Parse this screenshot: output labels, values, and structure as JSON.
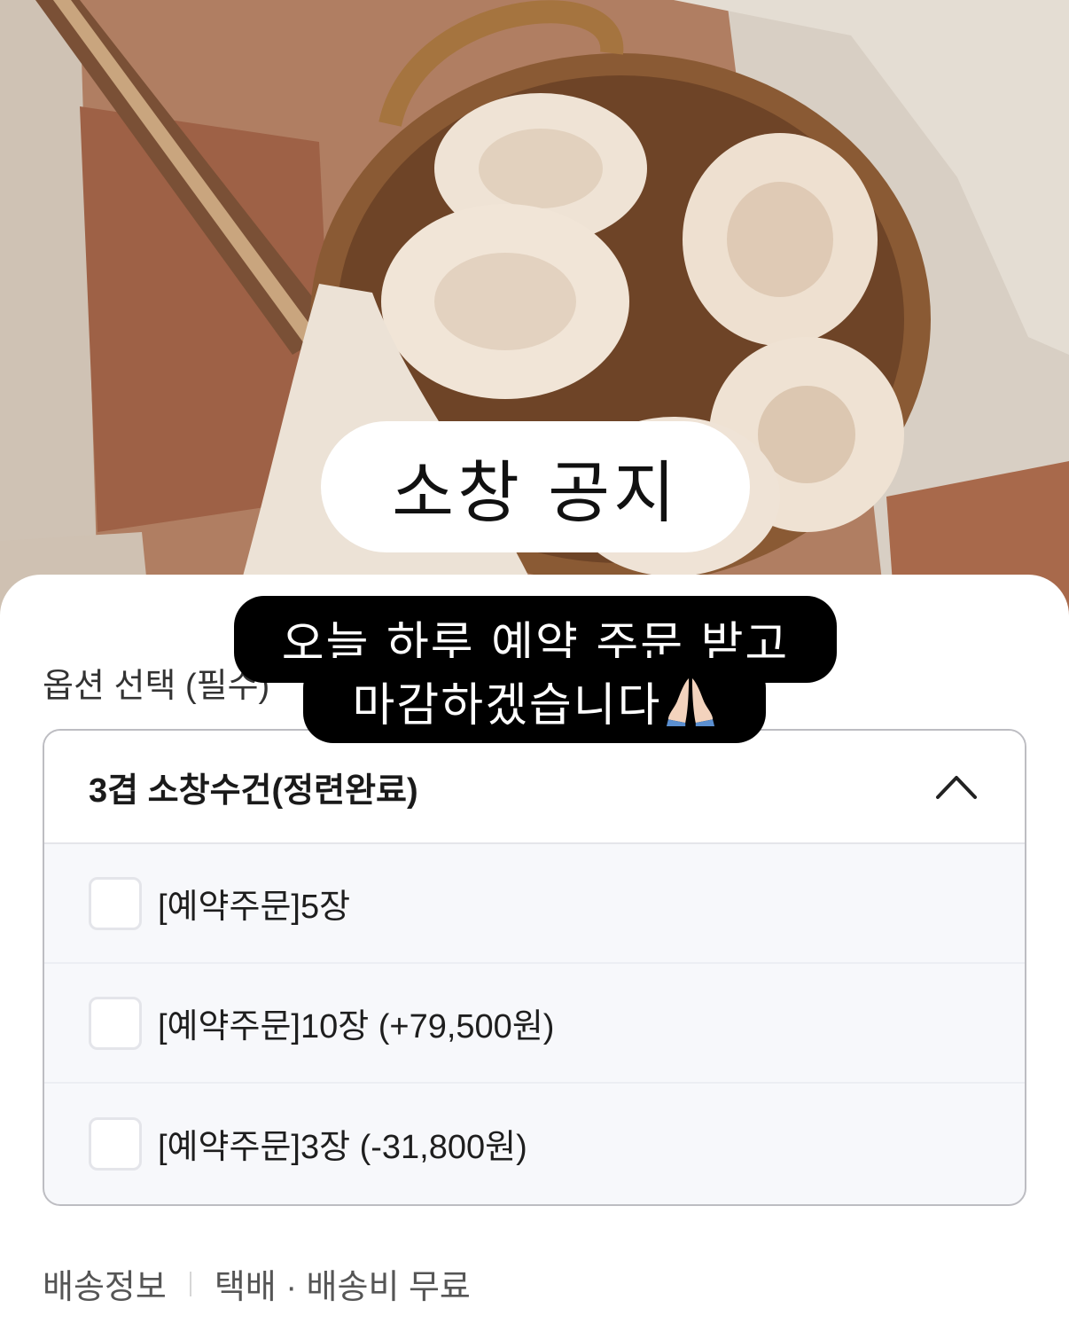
{
  "story": {
    "notice_title": "소창 공지",
    "caption_line1": "오늘 하루 예약 주문 받고",
    "caption_line2": "마감하겠습니다",
    "caption_emoji": "pray-hands-icon"
  },
  "option": {
    "label": "옵션 선택 (필수)",
    "selected_title": "3겹 소창수건(정련완료)",
    "items": [
      {
        "label": "[예약주문]5장",
        "checked": false
      },
      {
        "label": "[예약주문]10장 (+79,500원)",
        "checked": false
      },
      {
        "label": "[예약주문]3장 (-31,800원)",
        "checked": false
      }
    ]
  },
  "delivery": {
    "label": "배송정보",
    "value": "택배 · 배송비 무료"
  }
}
